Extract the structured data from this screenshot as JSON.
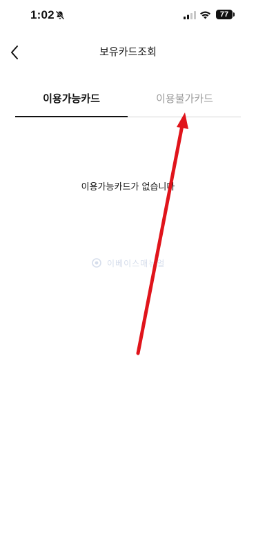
{
  "status_bar": {
    "time": "1:02",
    "battery_level": "77",
    "icons": [
      "bell-slash-icon",
      "signal-icon",
      "wifi-icon",
      "battery-icon"
    ]
  },
  "header": {
    "title": "보유카드조회",
    "back_icon": "chevron-left-icon"
  },
  "tabs": [
    {
      "label": "이용가능카드",
      "active": true
    },
    {
      "label": "이용불가카드",
      "active": false
    }
  ],
  "empty_state": {
    "message": "이용가능카드가 없습니다"
  },
  "watermark": {
    "text": "이베이스매뉴얼"
  },
  "colors": {
    "active_tab": "#111111",
    "inactive_tab": "#9a9a9a",
    "annotation_arrow": "#e0141b"
  }
}
